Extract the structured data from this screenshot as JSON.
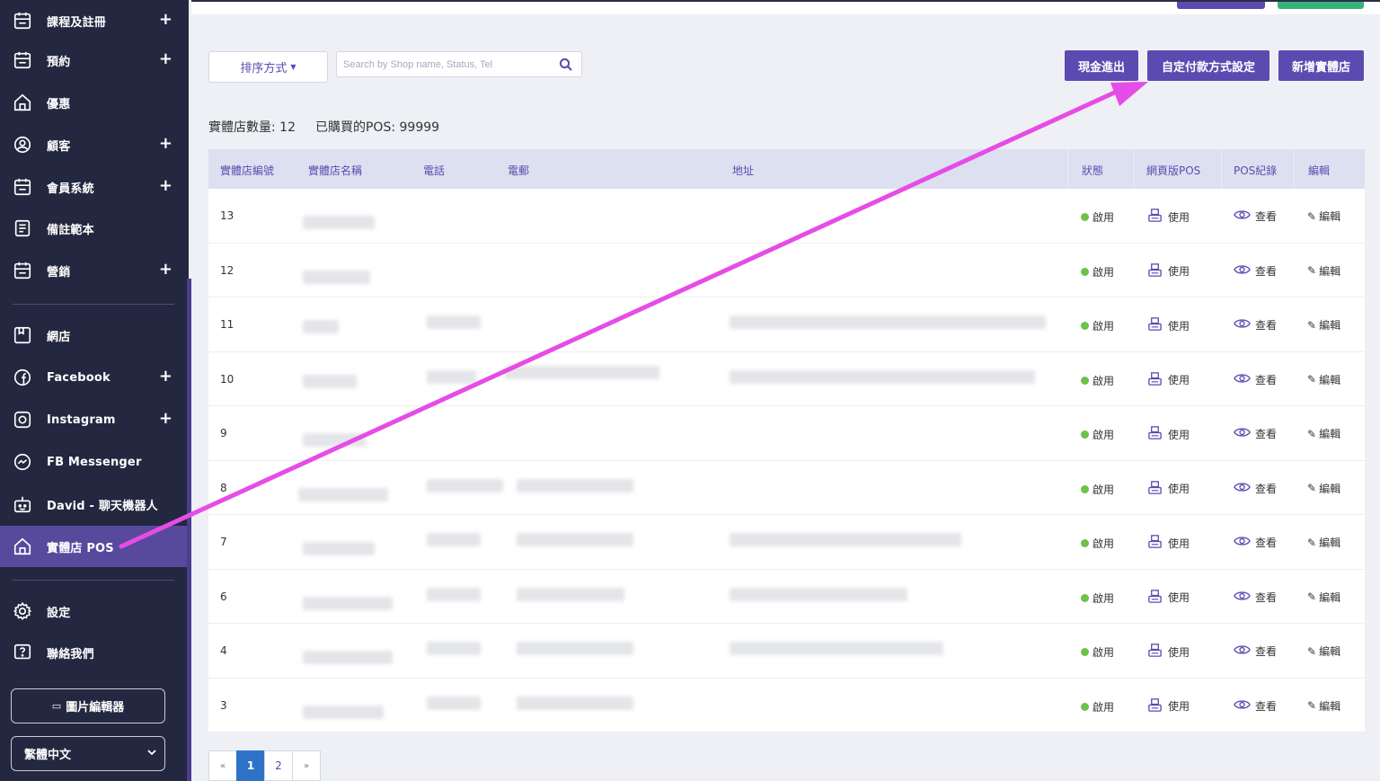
{
  "sidebar": {
    "items": [
      {
        "label": "課程及註冊",
        "icon": "calendar-icon",
        "has_plus": true
      },
      {
        "label": "預約",
        "icon": "calendar-icon",
        "has_plus": true
      },
      {
        "label": "優惠",
        "icon": "home-icon",
        "has_plus": false
      },
      {
        "label": "顧客",
        "icon": "user-circle-icon",
        "has_plus": true
      },
      {
        "label": "會員系統",
        "icon": "calendar-icon",
        "has_plus": true
      },
      {
        "label": "備註範本",
        "icon": "document-icon",
        "has_plus": false
      },
      {
        "label": "營銷",
        "icon": "calendar-icon",
        "has_plus": true
      },
      {
        "label": "網店",
        "icon": "store-icon",
        "has_plus": false
      },
      {
        "label": "Facebook",
        "icon": "facebook-icon",
        "has_plus": true
      },
      {
        "label": "Instagram",
        "icon": "instagram-icon",
        "has_plus": true
      },
      {
        "label": "FB Messenger",
        "icon": "messenger-icon",
        "has_plus": false
      },
      {
        "label": "David - 聊天機器人",
        "icon": "robot-icon",
        "has_plus": false
      },
      {
        "label": "實體店 POS",
        "icon": "home-icon",
        "has_plus": false,
        "active": true
      },
      {
        "label": "設定",
        "icon": "gear-icon",
        "has_plus": false
      },
      {
        "label": "聯絡我們",
        "icon": "help-icon",
        "has_plus": false
      }
    ],
    "plus_symbol": "+",
    "image_editor_label": "圖片編輯器",
    "language": "繁體中文"
  },
  "toolbar": {
    "sort_label": "排序方式",
    "search_placeholder": "Search by Shop name, Status, Tel",
    "cash_button": "現金進出",
    "payment_button": "自定付款方式設定",
    "add_store_button": "新增實體店"
  },
  "summary": {
    "store_count": "實體店數量: 12",
    "pos_purchased": "已購買的POS: 99999"
  },
  "table": {
    "headers": [
      "實體店編號",
      "實體店名稱",
      "電話",
      "電郵",
      "地址",
      "狀態",
      "網頁版POS",
      "POS紀錄",
      "編輯"
    ],
    "status_text": "啟用",
    "pos_text": "使用",
    "log_text": "查看",
    "edit_text": "編輯",
    "rows": [
      {
        "id": "13"
      },
      {
        "id": "12"
      },
      {
        "id": "11"
      },
      {
        "id": "10"
      },
      {
        "id": "9"
      },
      {
        "id": "8"
      },
      {
        "id": "7"
      },
      {
        "id": "6"
      },
      {
        "id": "4"
      },
      {
        "id": "3"
      }
    ]
  },
  "pagination": {
    "prev": "«",
    "pages": [
      "1",
      "2"
    ],
    "current": "1",
    "next": "»"
  },
  "colors": {
    "accent": "#5b4bb0",
    "sidebar_bg": "#232840",
    "status_green": "#6cc24a",
    "annotation_arrow": "#e64ce6"
  }
}
